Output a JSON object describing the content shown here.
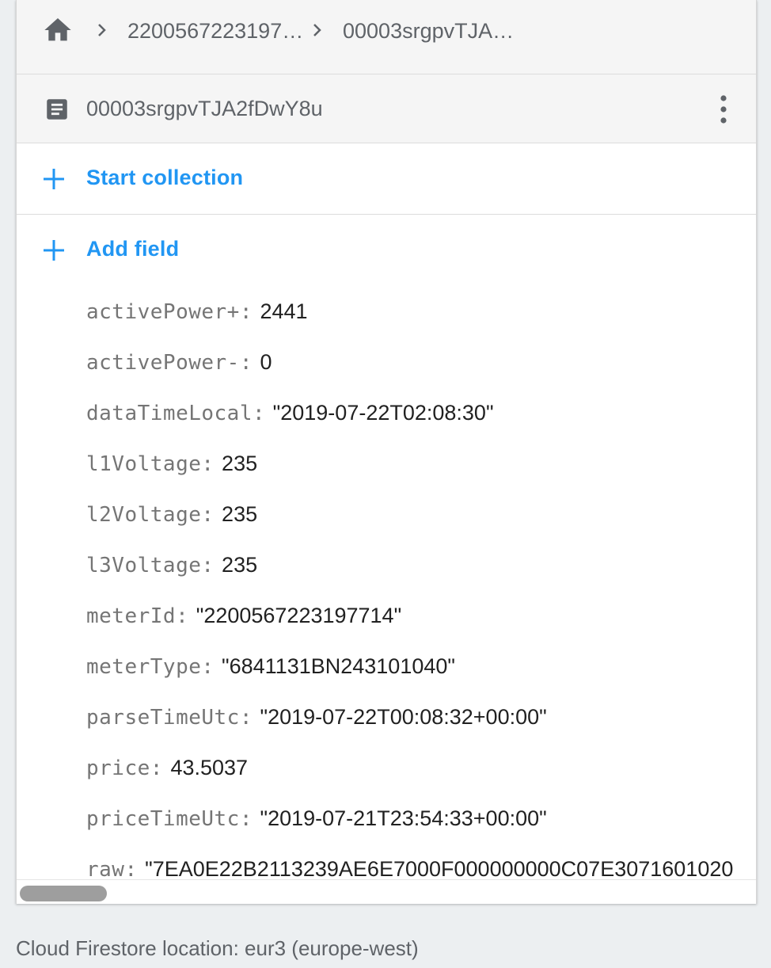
{
  "breadcrumb": {
    "items": [
      {
        "label": "2200567223197…"
      },
      {
        "label": "00003srgpvTJA…"
      }
    ]
  },
  "document": {
    "id": "00003srgpvTJA2fDwY8u"
  },
  "actions": {
    "start_collection": "Start collection",
    "add_field": "Add field"
  },
  "fields": [
    {
      "name": "activePower+",
      "value": "2441"
    },
    {
      "name": "activePower-",
      "value": "0"
    },
    {
      "name": "dataTimeLocal",
      "value": "\"2019-07-22T02:08:30\""
    },
    {
      "name": "l1Voltage",
      "value": "235"
    },
    {
      "name": "l2Voltage",
      "value": "235"
    },
    {
      "name": "l3Voltage",
      "value": "235"
    },
    {
      "name": "meterId",
      "value": "\"2200567223197714\""
    },
    {
      "name": "meterType",
      "value": "\"6841131BN243101040\""
    },
    {
      "name": "parseTimeUtc",
      "value": "\"2019-07-22T00:08:32+00:00\""
    },
    {
      "name": "price",
      "value": "43.5037"
    },
    {
      "name": "priceTimeUtc",
      "value": "\"2019-07-21T23:54:33+00:00\""
    },
    {
      "name": "raw",
      "value": "\"7EA0E22B2113239AE6E7000F000000000C07E3071601020"
    }
  ],
  "footer": {
    "location": "Cloud Firestore location: eur3 (europe-west)"
  },
  "colors": {
    "accent": "#2196f3",
    "header_bg": "#f5f5f5",
    "page_bg": "#eceff1"
  }
}
